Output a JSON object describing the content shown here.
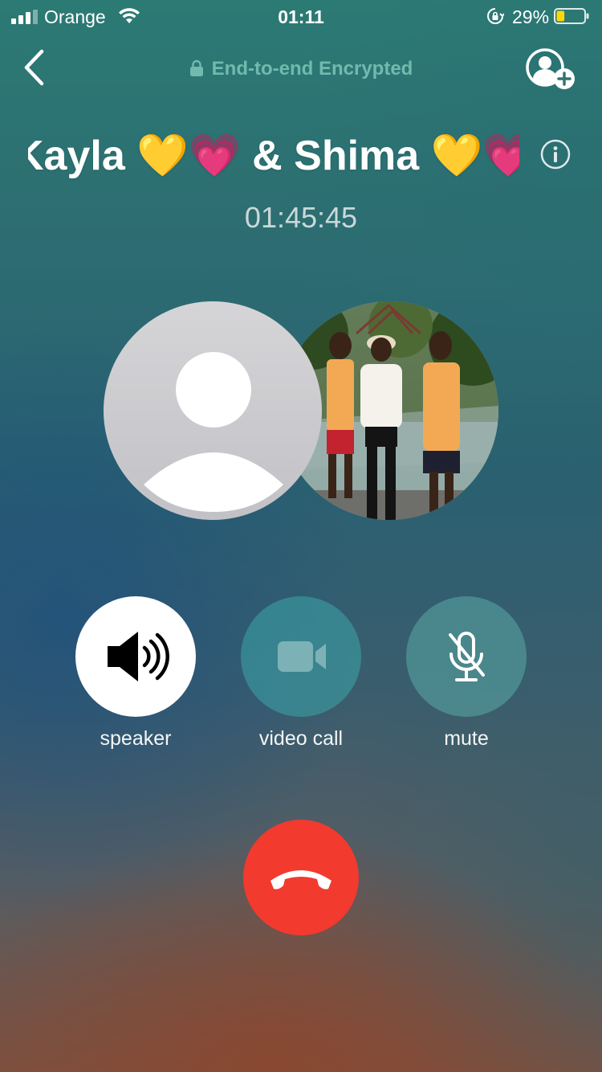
{
  "status_bar": {
    "carrier": "Orange",
    "time": "01:11",
    "battery_percent": "29%",
    "battery_level": 0.29,
    "icons": [
      "signal-icon",
      "wifi-icon",
      "rotation-lock-icon",
      "battery-icon"
    ]
  },
  "header": {
    "encryption_label": "End-to-end Encrypted",
    "icons": [
      "back-arrow-icon",
      "lock-icon",
      "add-participant-icon"
    ]
  },
  "call": {
    "title": "Kayla 💛💗 & Shima 💛💗",
    "timer": "01:45:45",
    "icons": [
      "info-icon"
    ]
  },
  "participants": [
    {
      "avatar": "default-person-icon"
    },
    {
      "avatar": "group-photo"
    }
  ],
  "controls": {
    "speaker_label": "speaker",
    "video_label": "video call",
    "mute_label": "mute",
    "icons": [
      "speaker-icon",
      "video-camera-icon",
      "microphone-muted-icon",
      "end-call-icon"
    ]
  },
  "colors": {
    "accent_encryption": "#72b9ae",
    "end_call": "#f23a2f",
    "battery_fill": "#ffd60a"
  }
}
